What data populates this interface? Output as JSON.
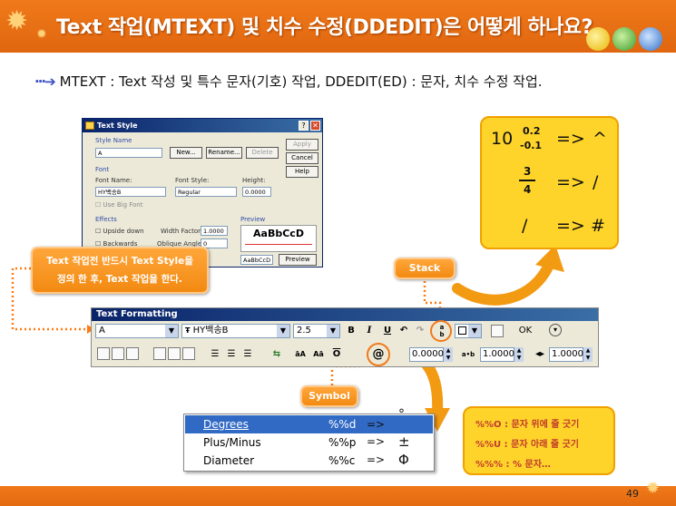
{
  "header": {
    "title": "Text 작업(MTEXT) 및 치수 수정(DDEDIT)은 어떻게 하나요?"
  },
  "intro": {
    "text": "MTEXT : Text 작성 및 특수 문자(기호) 작업, DDEDIT(ED) : 문자, 치수 수정 작업."
  },
  "dialog": {
    "title": "Text Style",
    "style_name_label": "Style Name",
    "style_name_value": "A",
    "new_label": "New...",
    "rename_label": "Rename...",
    "delete_label": "Delete",
    "apply_label": "Apply",
    "cancel_label": "Cancel",
    "help_label": "Help",
    "font_section": "Font",
    "font_name_label": "Font Name:",
    "font_name_value": "HY백송B",
    "font_style_label": "Font Style:",
    "font_style_value": "Regular",
    "height_label": "Height:",
    "height_value": "0.0000",
    "use_big_font_label": "Use Big Font",
    "effects_section": "Effects",
    "upside_down_label": "Upside down",
    "backwards_label": "Backwards",
    "width_factor_label": "Width Factor:",
    "width_factor_value": "1.0000",
    "oblique_angle_label": "Oblique Angle:",
    "oblique_angle_value": "0",
    "preview_section": "Preview",
    "preview_sample": "AaBbCcD",
    "preview_field_value": "AaBbCcD",
    "preview_button_label": "Preview"
  },
  "note_box": {
    "line1": "Text 작업전 반드시 Text Style을",
    "line2": "정의 한 후, Text 작업을 한다."
  },
  "stack_label": "Stack",
  "symbol_label": "Symbol",
  "stack_examples": {
    "row1_number": "10",
    "row1_upper": "0.2",
    "row1_lower": "-0.1",
    "row1_arrow": "=>",
    "row1_result": "^",
    "row2_upper": "3",
    "row2_lower": "4",
    "row2_arrow": "=>",
    "row2_result": "/",
    "row3_symbol": "/",
    "row3_arrow": "=>",
    "row3_result": "#"
  },
  "toolbar": {
    "title": "Text Formatting",
    "style_value": "A",
    "font_value": "HY백송B",
    "size_value": "2.5",
    "bold_label": "B",
    "italic_label": "I",
    "underline_label": "U",
    "ok_label": "OK",
    "oblique_value": "0.0000",
    "tracking_value": "1.0000",
    "width_value": "1.0000",
    "symbol_label": "@",
    "tracking_icon_label": "a•b"
  },
  "symbol_menu": {
    "items": [
      {
        "name": "Degrees",
        "code": "%%d",
        "arrow": "=>",
        "symbol": "°"
      },
      {
        "name": "Plus/Minus",
        "code": "%%p",
        "arrow": "=>",
        "symbol": "±"
      },
      {
        "name": "Diameter",
        "code": "%%c",
        "arrow": "=>",
        "symbol": "Φ"
      }
    ]
  },
  "symbol_notes": {
    "line1": "%%O : 문자 위에 줄 긋기",
    "line2": "%%U : 문자 아래 줄 긋기",
    "line3": "%%% : % 문자…"
  },
  "footer": {
    "page_number": "49"
  }
}
